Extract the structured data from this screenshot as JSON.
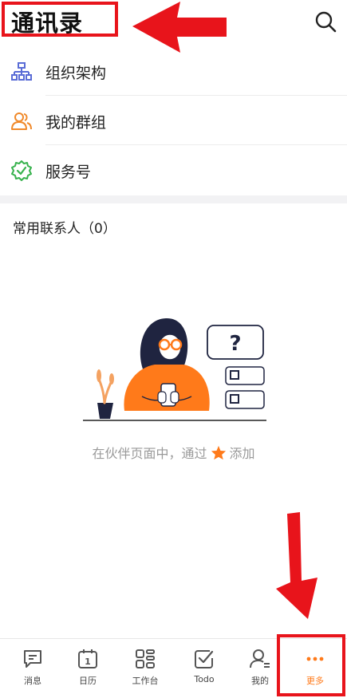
{
  "header": {
    "title": "通讯录",
    "icon": "search-icon"
  },
  "menu": {
    "items": [
      {
        "label": "组织架构",
        "icon": "org-chart-icon",
        "color": "#5a6cd6"
      },
      {
        "label": "我的群组",
        "icon": "group-icon",
        "color": "#f0892a"
      },
      {
        "label": "服务号",
        "icon": "verified-badge-icon",
        "color": "#37b24d"
      }
    ]
  },
  "frequent": {
    "title": "常用联系人（0）"
  },
  "empty_state": {
    "text_before": "在伙伴页面中，通过",
    "text_after": "添加",
    "question_mark": "?"
  },
  "tabbar": {
    "tabs": [
      {
        "label": "消息",
        "icon": "message-icon"
      },
      {
        "label": "日历",
        "icon": "calendar-icon",
        "badge": "1"
      },
      {
        "label": "工作台",
        "icon": "grid-icon"
      },
      {
        "label": "Todo",
        "icon": "checkbox-icon"
      },
      {
        "label": "我的",
        "icon": "user-icon"
      },
      {
        "label": "更多",
        "icon": "more-dots-icon",
        "active": true
      }
    ]
  },
  "colors": {
    "accent": "#ff7a1a",
    "annotation": "#e8141b"
  }
}
